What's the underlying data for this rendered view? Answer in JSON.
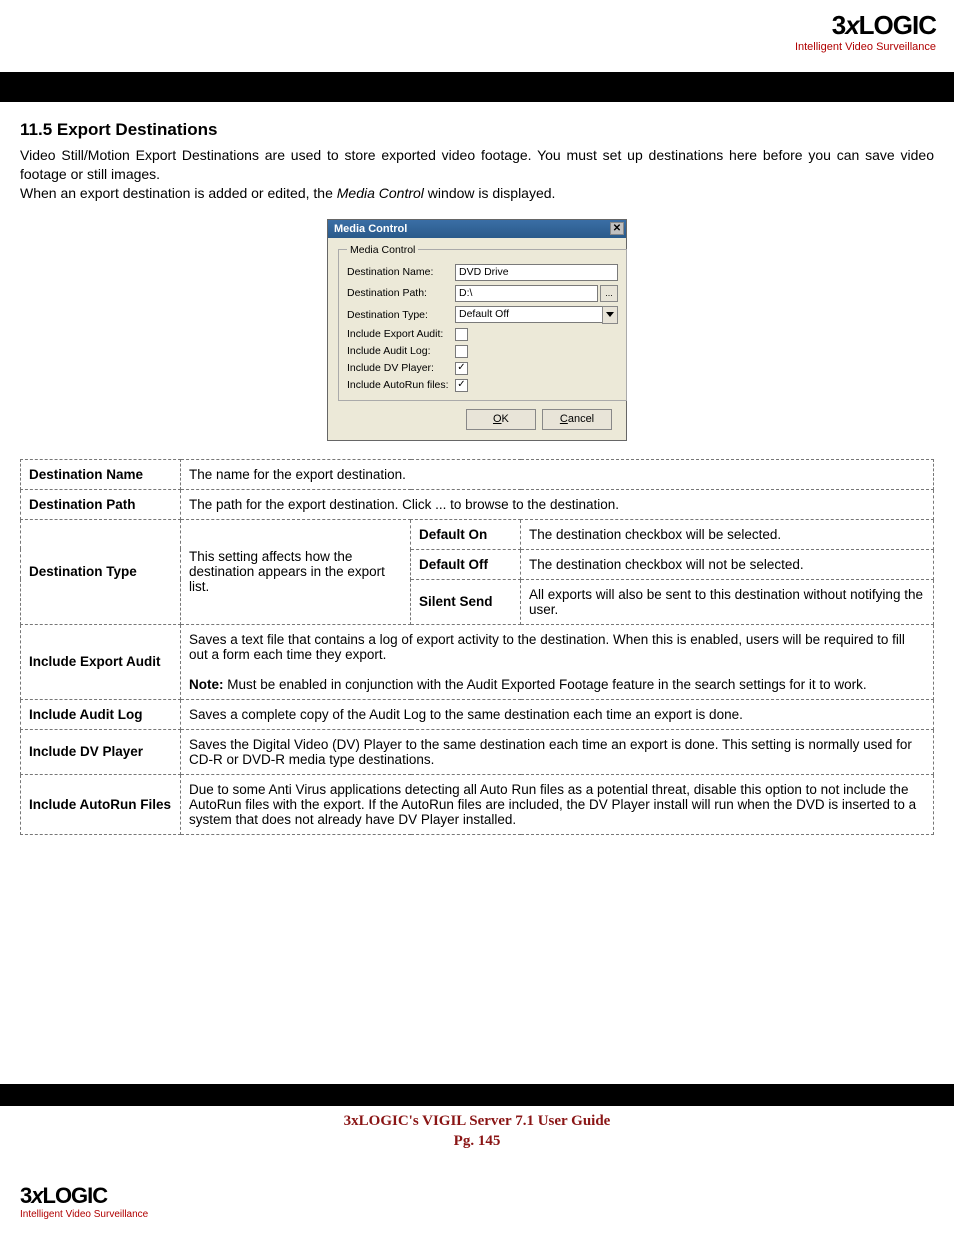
{
  "logo": {
    "brand": "3xLOGIC",
    "tagline": "Intelligent Video Surveillance"
  },
  "heading": "11.5 Export Destinations",
  "para1": "Video Still/Motion Export Destinations are used to store exported video footage. You must set up destinations here before you can save video footage or still images.",
  "para2_a": "When an export destination is added or edited, the ",
  "para2_em": "Media Control",
  "para2_b": " window is displayed.",
  "dialog": {
    "title": "Media Control",
    "legend": "Media Control",
    "fields": {
      "destName": {
        "label": "Destination Name:",
        "value": "DVD Drive"
      },
      "destPath": {
        "label": "Destination Path:",
        "value": "D:\\",
        "browse": "..."
      },
      "destType": {
        "label": "Destination Type:",
        "value": "Default Off"
      },
      "exportAudit": {
        "label": "Include Export Audit:",
        "checked": false
      },
      "auditLog": {
        "label": "Include Audit Log:",
        "checked": false
      },
      "dvPlayer": {
        "label": "Include DV Player:",
        "checked": true
      },
      "autorun": {
        "label": "Include AutoRun files:",
        "checked": true
      }
    },
    "ok": "OK",
    "cancel": "Cancel"
  },
  "table": {
    "r1": {
      "h": "Destination Name",
      "d": "The name for the export destination."
    },
    "r2": {
      "h": "Destination Path",
      "d": "The path for the export destination.  Click ... to browse to the destination."
    },
    "r3": {
      "h": "Destination Type",
      "d": "This setting affects how the destination appears in the export list.",
      "sub": {
        "a": {
          "h": "Default On",
          "d": "The destination checkbox will be selected."
        },
        "b": {
          "h": "Default Off",
          "d": "The destination checkbox will not be selected."
        },
        "c": {
          "h": "Silent Send",
          "d": "All exports will also be sent to this destination without notifying the user."
        }
      }
    },
    "r4": {
      "h": "Include Export Audit",
      "d1": "Saves a text file that contains a log of export activity to the destination. When this is enabled, users will be required to fill out a form each time they export.",
      "noteLabel": "Note:",
      "noteText": " Must be enabled in conjunction with the Audit Exported Footage feature in the search settings for it to work."
    },
    "r5": {
      "h": "Include Audit Log",
      "d": "Saves a complete copy of the Audit Log to the same destination each time an export is done."
    },
    "r6": {
      "h": "Include DV Player",
      "d": "Saves the Digital Video (DV) Player to the same destination each time an export is done.  This setting is normally used for CD-R or DVD-R media type destinations."
    },
    "r7": {
      "h": "Include AutoRun Files",
      "d": "Due to some Anti Virus applications detecting all Auto Run files as a potential threat, disable this option to not include the AutoRun files with the export.  If the AutoRun files are included, the DV Player install will run when the DVD is inserted to a system that does not already have DV Player installed."
    }
  },
  "footer": {
    "title": "3xLOGIC's VIGIL Server 7.1 User Guide",
    "page": "Pg. 145"
  }
}
